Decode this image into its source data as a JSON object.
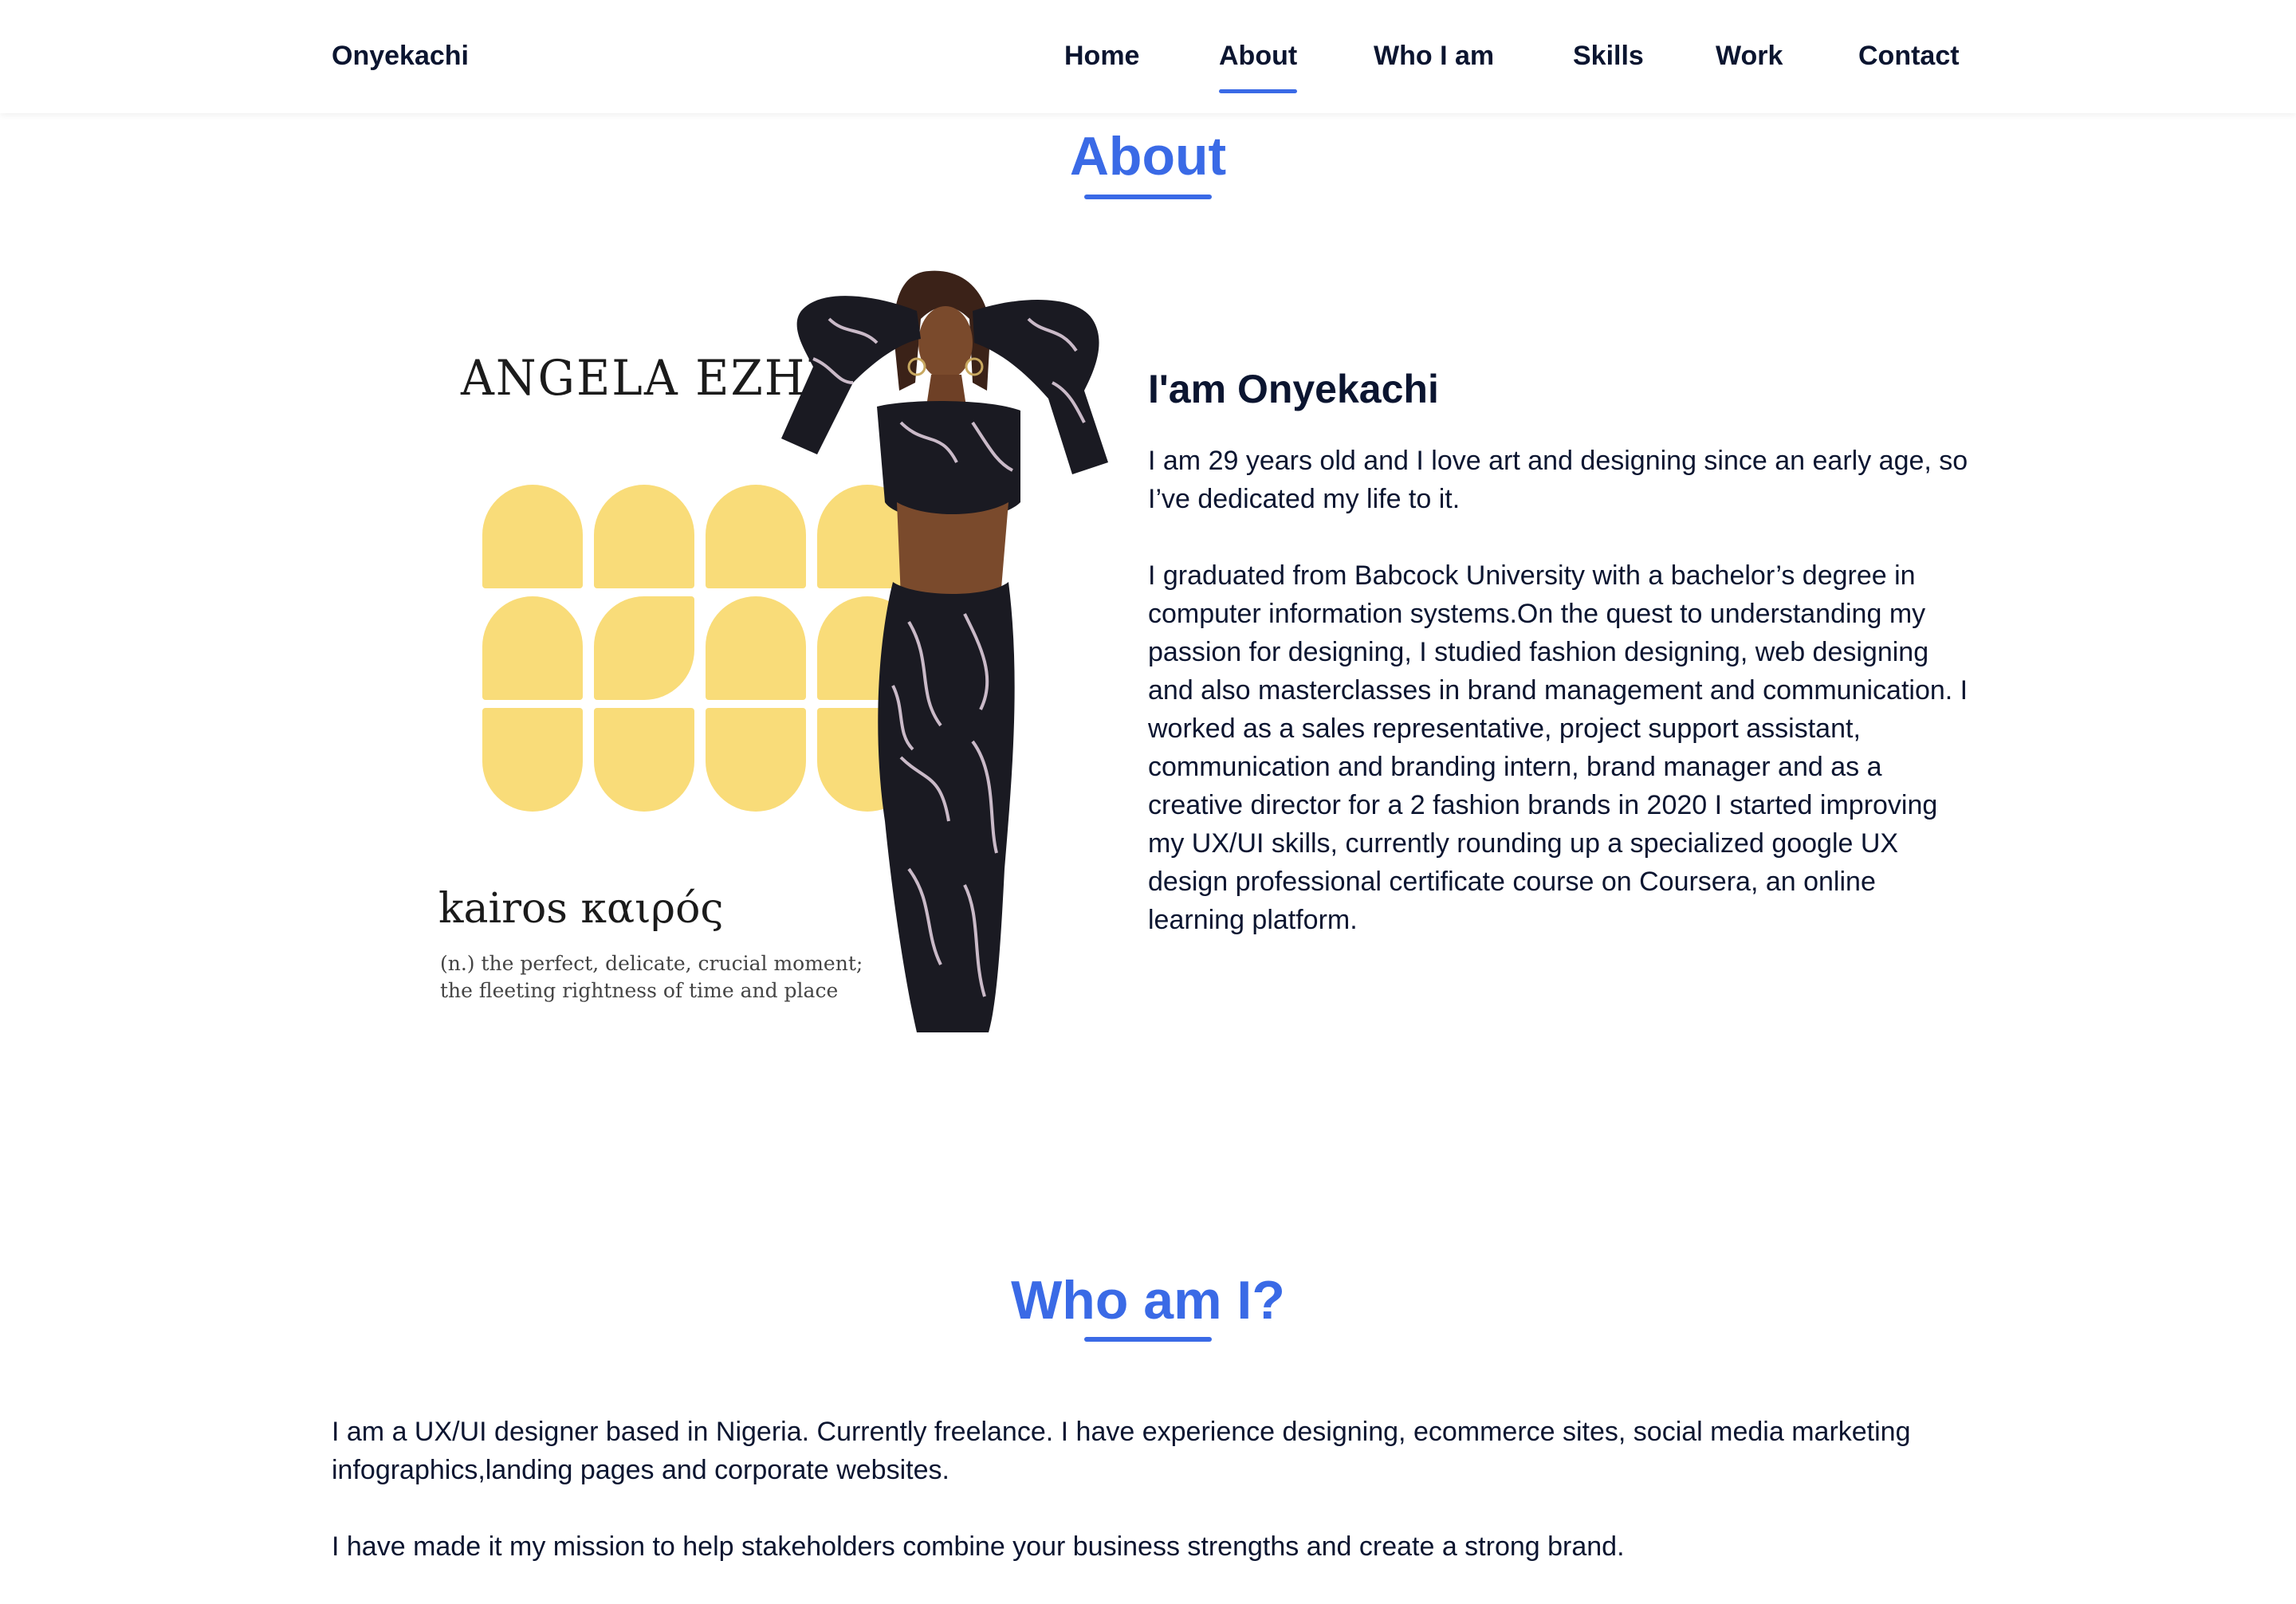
{
  "header": {
    "brand": "Onyekachi",
    "nav": [
      {
        "label": "Home"
      },
      {
        "label": "About",
        "active": true
      },
      {
        "label": "Who I am"
      },
      {
        "label": "Skills"
      },
      {
        "label": "Work"
      },
      {
        "label": "Contact"
      }
    ]
  },
  "about": {
    "title": "About",
    "image": {
      "wordmark": "ANGELA EZHE",
      "word": "kairos καιρός",
      "definition_line1": "(n.) the perfect, delicate, crucial moment;",
      "definition_line2": "the fleeting rightness of time and place"
    },
    "heading": "I'am Onyekachi",
    "paragraphs": [
      "I am 29 years old and I love art and designing since an early age, so I’ve dedicated my life to it.",
      "I graduated from Babcock University with a bachelor’s degree in computer information systems.On the quest to understanding my passion for designing, I studied fashion designing, web designing and also masterclasses in brand management and communication. I worked as a sales representative, project support assistant, communication and branding intern, brand manager and as a creative director for a 2 fashion brands in 2020 I started improving my UX/UI skills, currently rounding up a specialized google UX design professional certificate course on Coursera, an online learning platform."
    ]
  },
  "who": {
    "title": "Who am I?",
    "paragraphs": [
      "I am a UX/UI designer based in Nigeria. Currently freelance. I have experience designing, ecommerce sites, social media marketing infographics,landing pages and corporate websites.",
      "I have made it my mission to help stakeholders combine your business strengths and create a strong brand."
    ]
  },
  "colors": {
    "accent": "#3a6ae6",
    "text": "#0b1530",
    "tile_yellow": "#f9dc79"
  }
}
